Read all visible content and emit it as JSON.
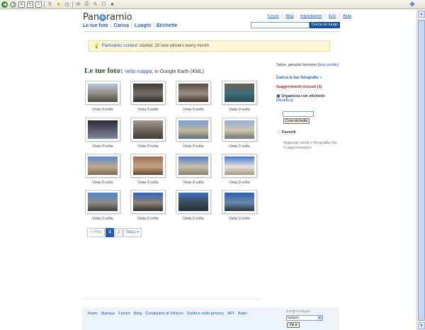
{
  "header": {
    "logo_text_left": "Pan",
    "logo_globe": "+",
    "logo_text_right": "ramio",
    "top_links": [
      "Forum",
      "Blog",
      "Impostazioni",
      "Esci",
      "Aiuto"
    ],
    "nav": [
      "Le tue foto",
      "Carica",
      "Luoghi",
      "Etichette"
    ],
    "search_button": "Cerca un luogo"
  },
  "notice": {
    "link": "Panoramio contest",
    "text": "started. 28 new winners every month"
  },
  "page": {
    "heading": "Le tue foto:",
    "map_link": "nella mappa",
    "earth_text": ", in Google Earth (KML)"
  },
  "photos": [
    {
      "caption": "Vista 0 volte",
      "colors": [
        "#b9c7d8",
        "#8d8a80",
        "#4e4a45"
      ]
    },
    {
      "caption": "Vista 0 volte",
      "colors": [
        "#3f3a35",
        "#75706a",
        "#2d2a27"
      ]
    },
    {
      "caption": "Vista 0 volte",
      "colors": [
        "#554b42",
        "#9a8d80",
        "#3d3631"
      ]
    },
    {
      "caption": "Vista 0 volte",
      "colors": [
        "#6e5e52",
        "#3b6f7a",
        "#2f4b57"
      ]
    },
    {
      "caption": "Vista 0 volte",
      "colors": [
        "#2b2b30",
        "#5b5f6e",
        "#7c8796"
      ]
    },
    {
      "caption": "Vista 0 volte",
      "colors": [
        "#a1998f",
        "#6a645d",
        "#3f3b37"
      ]
    },
    {
      "caption": "Vista 0 volte",
      "colors": [
        "#6f9ed8",
        "#c5b59c",
        "#5b6f78"
      ]
    },
    {
      "caption": "Vista 0 volte",
      "colors": [
        "#8fb1dd",
        "#d1c3a8",
        "#6b7576"
      ]
    },
    {
      "caption": "Vista 0 volte",
      "colors": [
        "#5a8bd0",
        "#bfa88b",
        "#7f6a57"
      ]
    },
    {
      "caption": "Vista 0 volte",
      "colors": [
        "#9d6e56",
        "#c9a27e",
        "#5f4c3e"
      ]
    },
    {
      "caption": "Vista 0 volte",
      "colors": [
        "#4d7dc7",
        "#c9bfae",
        "#8a7c6c"
      ]
    },
    {
      "caption": "Vista 0 volte",
      "colors": [
        "#3f78d0",
        "#eae4d8",
        "#a19985"
      ]
    },
    {
      "caption": "Vista 0 volte",
      "colors": [
        "#4f86d6",
        "#8e8a85",
        "#403c39"
      ]
    },
    {
      "caption": "Vista 0 volte",
      "colors": [
        "#2f64be",
        "#8d8177",
        "#34302c"
      ]
    },
    {
      "caption": "Vista 0 volte",
      "colors": [
        "#3d6fc4",
        "#3d4b58",
        "#1f2c3a"
      ]
    },
    {
      "caption": "Vista 0 volte",
      "colors": [
        "#2e5fb7",
        "#6d88a8",
        "#25354a"
      ]
    }
  ],
  "pager": {
    "prev": "« Prec",
    "pages": [
      "1",
      "2"
    ],
    "current": "1",
    "next": "Succ »"
  },
  "sidebar": {
    "greeting": "Salve, gerardo bonomo",
    "tour_link": "[tour profile]",
    "upload_link": "Carica le tue fotografie »",
    "suggestions_link": "Suggerimenti ricevuti (1)",
    "tags_title": "Organizza con etichette",
    "tags_edit": "[Modifica]",
    "create_tag_button": "Crea etichetta",
    "favorites_title": "Favoriti",
    "favorites_text": "Aggiungi utenti o fotografie che ti rappresentano"
  },
  "footer": {
    "links": [
      "Team",
      "Stampa",
      "Forum",
      "Blog",
      "Condizioni di Utilizzo",
      "Politica sulla privacy",
      "API",
      "Aiuto"
    ],
    "lang_label": "Scegli la lingua",
    "lang_value": "Italiano",
    "lang_button": "Vai a"
  },
  "icons": {
    "back": "back-arrow-icon",
    "forward": "forward-arrow-icon",
    "notice": "lightbulb-icon",
    "tags": "tag-icon",
    "favorites": "star-icon"
  }
}
